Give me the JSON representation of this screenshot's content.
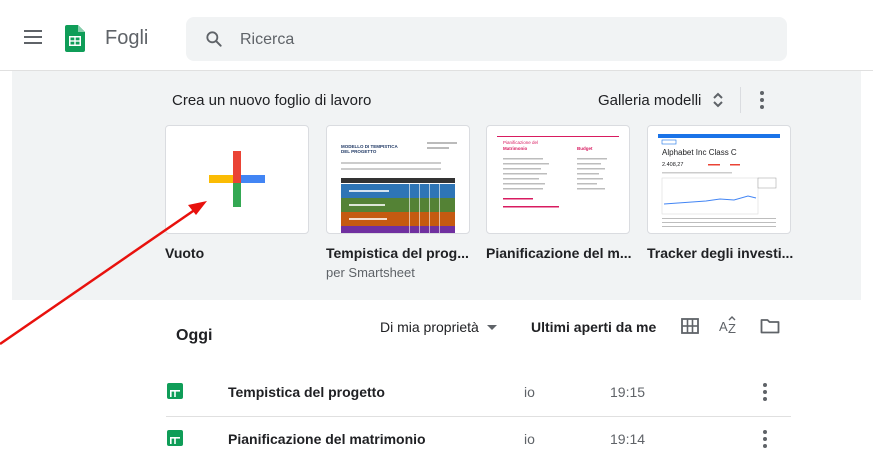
{
  "app": {
    "title": "Fogli",
    "accent_color": "#0f9d58"
  },
  "search": {
    "placeholder": "Ricerca",
    "value": ""
  },
  "templates": {
    "heading": "Crea un nuovo foglio di lavoro",
    "gallery_label": "Galleria modelli",
    "cards": [
      {
        "name": "Vuoto",
        "subtitle": ""
      },
      {
        "name": "Tempistica del prog...",
        "subtitle": "per Smartsheet",
        "thumb_title": "MODELLO DI TEMPISTICA DEL PROGETTO"
      },
      {
        "name": "Pianificazione del m...",
        "subtitle": "",
        "thumb_title": "Pianificazione del",
        "thumb_subtitle": "Matrimonio",
        "thumb_side": "Budget"
      },
      {
        "name": "Tracker degli investi...",
        "subtitle": "",
        "thumb_title": "Alphabet Inc Class C",
        "thumb_value": "2.408,27"
      }
    ]
  },
  "list": {
    "section_title": "Oggi",
    "owner_filter": "Di mia proprietà",
    "sort_column": "Ultimi aperti da me",
    "rows": [
      {
        "name": "Tempistica del progetto",
        "owner": "io",
        "time": "19:15"
      },
      {
        "name": "Pianificazione del matrimonio",
        "owner": "io",
        "time": "19:14"
      }
    ]
  },
  "icons": {
    "menu": "hamburger-icon",
    "search": "search-icon",
    "more": "more-vert-icon",
    "grid": "grid-view-icon",
    "sort": "sort-az-icon",
    "folder": "folder-icon",
    "annotation": "red-arrow"
  }
}
